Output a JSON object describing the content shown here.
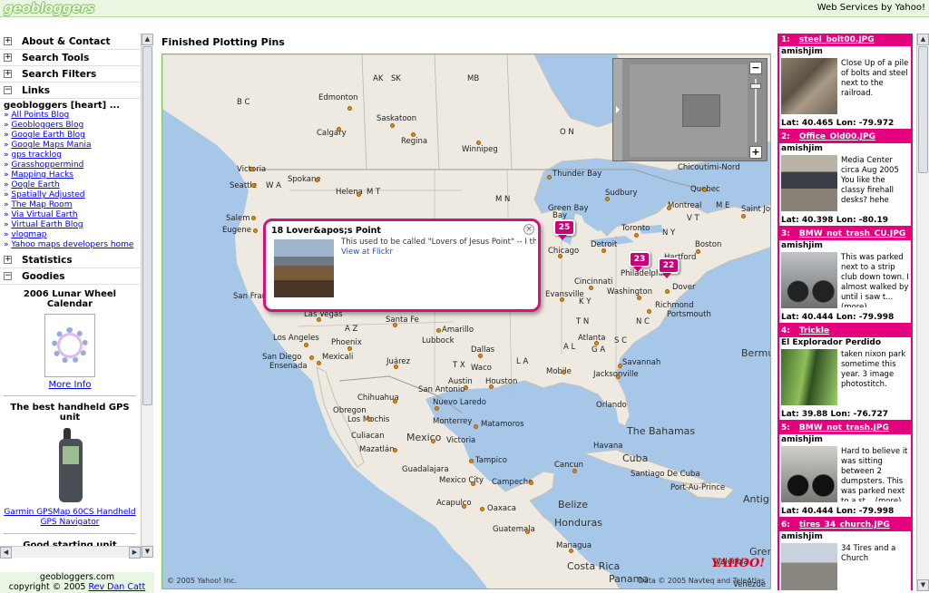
{
  "topbar": {
    "logo": "geobloggers",
    "credit": "Web Services by Yahoo!"
  },
  "sidebar": {
    "sections": [
      {
        "label": "About & Contact",
        "toggle": "+"
      },
      {
        "label": "Search Tools",
        "toggle": "+"
      },
      {
        "label": "Search Filters",
        "toggle": "+"
      },
      {
        "label": "Links",
        "toggle": "−"
      }
    ],
    "blog_title": "geobloggers [heart] ...",
    "links": [
      "All Points Blog",
      "Geobloggers Blog",
      "Google Earth Blog",
      "Google Maps Mania",
      "gps tracklog",
      "Grasshoppermind",
      "Mapping Hacks",
      "Oogle Earth",
      "Spatially Adjusted",
      "The Map Room",
      "Via Virtual Earth",
      "Virtual Earth Blog",
      "vlogmap",
      "Yahoo maps developers home"
    ],
    "statistics": {
      "label": "Statistics",
      "toggle": "+"
    },
    "goodies": {
      "label": "Goodies",
      "toggle": "−"
    },
    "goodie1_title": "2006 Lunar Wheel Calendar",
    "more_info": "More Info",
    "goodie2_title": "The best handheld GPS unit",
    "gps_caption": "Garmin GPSMap 60CS Handheld GPS Navigator",
    "goodie3_title": "Good starting unit"
  },
  "footer": {
    "line1": "geobloggers.com",
    "line2_prefix": "copyright © 2005 ",
    "author": "Rev Dan Catt"
  },
  "main": {
    "title": "Finished Plotting Pins"
  },
  "map": {
    "labels": {
      "AK": "AK",
      "SK": "SK",
      "MB": "MB",
      "BC": "B C",
      "Edmonton": "Edmonton",
      "Saskatoon": "Saskatoon",
      "Calgary": "Calgary",
      "Regina": "Regina",
      "Winnipeg": "Winnipeg",
      "ON": "O N",
      "Victoria": "Victoria",
      "Seattle": "Seattle",
      "Spokane": "Spokane",
      "WA": "W A",
      "Helena": "Helena",
      "MT": "M T",
      "ThunderBay": "Thunder Bay",
      "Chicoutimi": "Chicoutimi-Nord",
      "Quebec": "Quebec",
      "Sudbury": "Sudbury",
      "Montreal": "Montreal",
      "VT": "V T",
      "ME": "M E",
      "StJohn": "Saint John",
      "Salem": "Salem",
      "Eugene": "Eugene",
      "MN": "M N",
      "GreenBay": "Green Bay",
      "Toronto": "Toronto",
      "NY": "N Y",
      "Boston": "Boston",
      "Detroit": "Detroit",
      "Chicago": "Chicago",
      "Hartford": "Hartford",
      "Cincinnati": "Cincinnati",
      "Philadelphia": "Philadelphia",
      "Washington": "Washington",
      "Dover": "Dover",
      "Evansville": "Evansville",
      "KY": "K Y",
      "Richmond": "Richmond",
      "Portsmouth": "Portsmouth",
      "SanFran": "San Fran",
      "LasVegas": "Las Vegas",
      "SantaFe": "Santa Fe",
      "Amarillo": "Amarillo",
      "NC": "N C",
      "TN": "T N",
      "LosAngeles": "Los Angeles",
      "AZ": "A Z",
      "Phoenix": "Phoenix",
      "Lubbock": "Lubbock",
      "Dallas": "Dallas",
      "AL": "A L",
      "GA": "G A",
      "Atlanta": "Atlanta",
      "SC": "S C",
      "SanDiego": "San Diego",
      "Ensenada": "Ensenada",
      "Mexicali": "Mexicali",
      "Juarez": "Juárez",
      "TX": "T X",
      "Waco": "Waco",
      "LA": "L A",
      "Mobile": "Mobile",
      "Savannah": "Savannah",
      "Jacksonville": "Jacksonville",
      "Bermuda": "Bermu",
      "Austin": "Austin",
      "Houston": "Houston",
      "SanAntonio": "San Antonio",
      "Chihuahua": "Chihuahua",
      "NuevoLaredo": "Nuevo Laredo",
      "Orlando": "Orlando",
      "Obregon": "Obregon",
      "LosMochis": "Los Mochis",
      "Monterrey": "Monterrey",
      "Matamoros": "Matamoros",
      "Culiacan": "Culiacan",
      "Mexico": "Mexico",
      "Mazatlan": "Mazatlán",
      "Bahamas": "The Bahamas",
      "Havana": "Havana",
      "Cuba": "Cuba",
      "Guadalajara": "Guadalajara",
      "Tampico": "Tampico",
      "Cancun": "Cancun",
      "MexicoCity": "Mexico City",
      "Campeche": "Campeche",
      "SantiagoCuba": "Santiago De Cuba",
      "PortauPrince": "Port-Au-Prince",
      "Antigua": "Antigu",
      "Acapulco": "Acapulco",
      "Oaxaca": "Oaxaca",
      "Belize": "Belize",
      "Guatemala": "Guatemala",
      "Honduras": "Honduras",
      "Managua": "Managua",
      "CostaRica": "Costa Rica",
      "Panama": "Panama",
      "Green": "Gren",
      "Caracas": "Valencia",
      "Venezuela": "Venezue",
      "Bay": "Bay"
    },
    "pins": [
      "25",
      "23",
      "22"
    ],
    "popup": {
      "title": "18 Lover&apos;s Point",
      "desc": "This used to be called \"Lovers of Jesus Point\" -- I think tl",
      "link": "View at Flickr"
    },
    "zoom_in": "−",
    "zoom_out": "+",
    "copyright": "© 2005 Yahoo! Inc.",
    "data_credit": "Data © 2005 Navteq and TeleAtlas",
    "provider_logo": "YAHOO!"
  },
  "cards": [
    {
      "num": "1:",
      "file": "steel_bolt00.JPG",
      "user": "amishjim",
      "desc": "Close Up of a pile of bolts and steel next to the railroad.",
      "latlon": "Lat: 40.465  Lon: -79.972"
    },
    {
      "num": "2:",
      "file": "Office_Old00.JPG",
      "user": "amishjim",
      "desc": "Media Center circa Aug 2005 You like the classy firehall desks? hehe",
      "latlon": "Lat: 40.398  Lon: -80.19"
    },
    {
      "num": "3:",
      "file": "BMW_not_trash_CU.JPG",
      "user": "amishjim",
      "desc": "This was parked next to a strip club down town. I almost walked by until i saw t... (more)",
      "latlon": "Lat: 40.444  Lon: -79.998"
    },
    {
      "num": "4:",
      "file": "Trickle",
      "user": "El Explorador Perdido",
      "desc": "taken nixon park sometime this year. 3 image photostitch.",
      "latlon": "Lat: 39.88  Lon: -76.727"
    },
    {
      "num": "5:",
      "file": "BMW_not_trash.JPG",
      "user": "amishjim",
      "desc": "Hard to believe it was sitting between 2 dumpsters. This was parked next to a st... (more)",
      "latlon": "Lat: 40.444  Lon: -79.998"
    },
    {
      "num": "6:",
      "file": "tires_34_church.JPG",
      "user": "amishjim",
      "desc": "34 Tires and a Church",
      "latlon": ""
    }
  ]
}
